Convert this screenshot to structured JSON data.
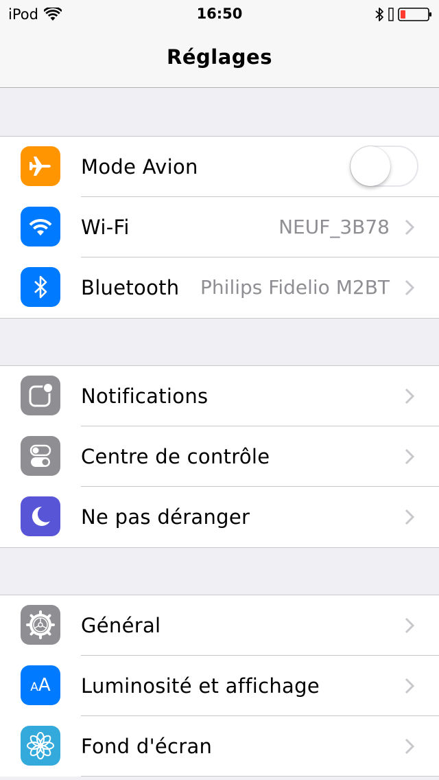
{
  "status_bar": {
    "carrier": "iPod",
    "time": "16:50",
    "battery_color": "#ff3b30"
  },
  "nav": {
    "title": "Réglages"
  },
  "groups": [
    {
      "rows": [
        {
          "label": "Mode Avion",
          "icon": "airplane-icon",
          "icon_bg": "#ff9500",
          "toggle_on": false
        },
        {
          "label": "Wi-Fi",
          "value": "NEUF_3B78",
          "icon": "wifi-icon",
          "icon_bg": "#007aff"
        },
        {
          "label": "Bluetooth",
          "value": "Philips Fidelio M2BT",
          "icon": "bluetooth-icon",
          "icon_bg": "#007aff"
        }
      ]
    },
    {
      "rows": [
        {
          "label": "Notifications",
          "icon": "notifications-icon",
          "icon_bg": "#8e8e93"
        },
        {
          "label": "Centre de contrôle",
          "icon": "control-center-icon",
          "icon_bg": "#8e8e93"
        },
        {
          "label": "Ne pas déranger",
          "icon": "moon-icon",
          "icon_bg": "#5856d6"
        }
      ]
    },
    {
      "rows": [
        {
          "label": "Général",
          "icon": "gear-icon",
          "icon_bg": "#8e8e93"
        },
        {
          "label": "Luminosité et affichage",
          "icon": "text-size-icon",
          "icon_bg": "#007aff",
          "icon_text": "AA"
        },
        {
          "label": "Fond d'écran",
          "icon": "flower-icon",
          "icon_bg": "#34aadc"
        }
      ]
    }
  ]
}
